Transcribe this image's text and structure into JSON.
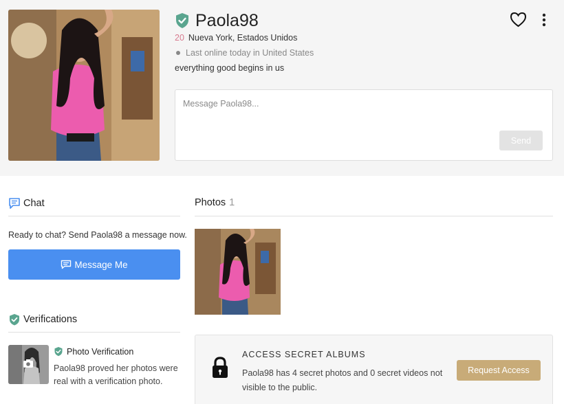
{
  "profile": {
    "username": "Paola98",
    "age": "20",
    "location": "Nueva York, Estados Unidos",
    "last_online": "Last online today in United States",
    "bio": "everything good begins in us"
  },
  "message": {
    "placeholder": "Message Paola98...",
    "send_label": "Send"
  },
  "chat": {
    "heading": "Chat",
    "prompt": "Ready to chat? Send Paola98 a message now.",
    "button_label": "Message Me"
  },
  "photos": {
    "heading": "Photos",
    "count": "1"
  },
  "verifications": {
    "heading": "Verifications",
    "item_title": "Photo Verification",
    "item_desc": "Paola98 proved her photos were real with a verification photo."
  },
  "secret_albums": {
    "title": "ACCESS SECRET ALBUMS",
    "desc": "Paola98 has 4 secret photos and 0 secret videos not visible to the public.",
    "button_label": "Request Access"
  },
  "icons": {
    "verified": "verified-badge-icon",
    "favorite": "heart-icon",
    "more": "more-vertical-icon",
    "chat": "chat-bubble-icon",
    "lock": "lock-icon",
    "camera": "camera-icon"
  },
  "colors": {
    "accent_blue": "#4a8ff0",
    "verified_green": "#5aa58f",
    "age_pink": "#d77b8f",
    "request_gold": "#c8ab78"
  }
}
